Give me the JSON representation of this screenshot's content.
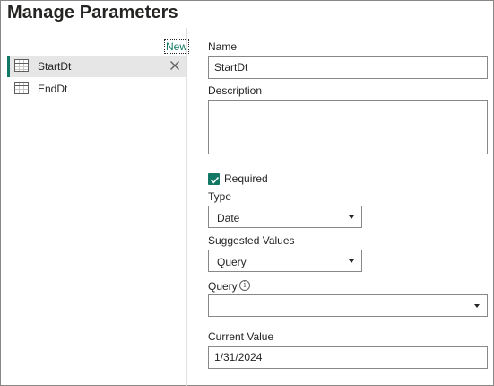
{
  "dialog": {
    "title": "Manage Parameters",
    "new_link": "New"
  },
  "parameters": [
    {
      "label": "StartDt",
      "selected": true
    },
    {
      "label": "EndDt",
      "selected": false
    }
  ],
  "form": {
    "name_label": "Name",
    "name_value": "StartDt",
    "description_label": "Description",
    "description_value": "",
    "required_label": "Required",
    "required_checked": true,
    "type_label": "Type",
    "type_value": "Date",
    "suggested_label": "Suggested Values",
    "suggested_value": "Query",
    "query_label": "Query",
    "query_value": "",
    "current_label": "Current Value",
    "current_value": "1/31/2024"
  },
  "icons": {
    "table": "table-icon",
    "close": "close-icon",
    "check": "checkmark-icon",
    "dropdown": "chevron-down-icon",
    "info": "info-icon"
  },
  "colors": {
    "accent": "#117865",
    "selected_bg": "#e6e6e6",
    "border": "#8a8886"
  }
}
